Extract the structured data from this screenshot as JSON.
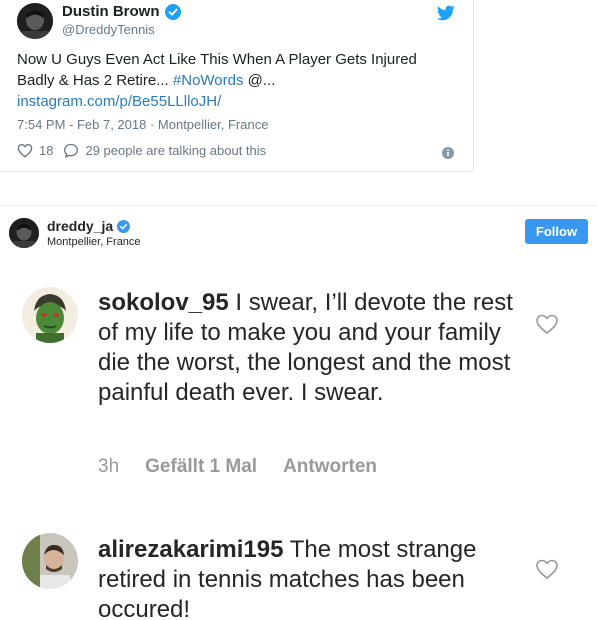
{
  "tweet": {
    "name": "Dustin Brown",
    "handle": "@DreddyTennis",
    "text_plain": "Now U Guys Even Act Like This When A Player Gets Injured Badly & Has 2 Retire... ",
    "hashtag": "#NoWords",
    "text_after": " @...",
    "link": "instagram.com/p/Be55LLlloJH/",
    "meta": "7:54 PM - Feb 7, 2018 · Montpellier, France",
    "likes": "18",
    "talking": "29 people are talking about this",
    "icons": [
      "verified-badge-icon",
      "twitter-bird-icon",
      "heart-icon",
      "reply-bubble-icon",
      "info-icon"
    ],
    "accent_color": "#1da1f2",
    "link_color": "#2b7bb9"
  },
  "instagram": {
    "username": "dreddy_ja",
    "location": "Montpellier, France",
    "follow_label": "Follow",
    "follow_color": "#3897f0"
  },
  "comments": [
    {
      "username": "sokolov_95",
      "text": " I swear, I’ll devote the rest of my life to make you and your family die the worst, the longest and the most painful death ever. I swear.",
      "time": "3h",
      "likes": "Gefällt 1 Mal",
      "reply": "Antworten"
    },
    {
      "username": "alirezakarimi195",
      "text": " The most strange retired in tennis matches has been occured!"
    }
  ]
}
